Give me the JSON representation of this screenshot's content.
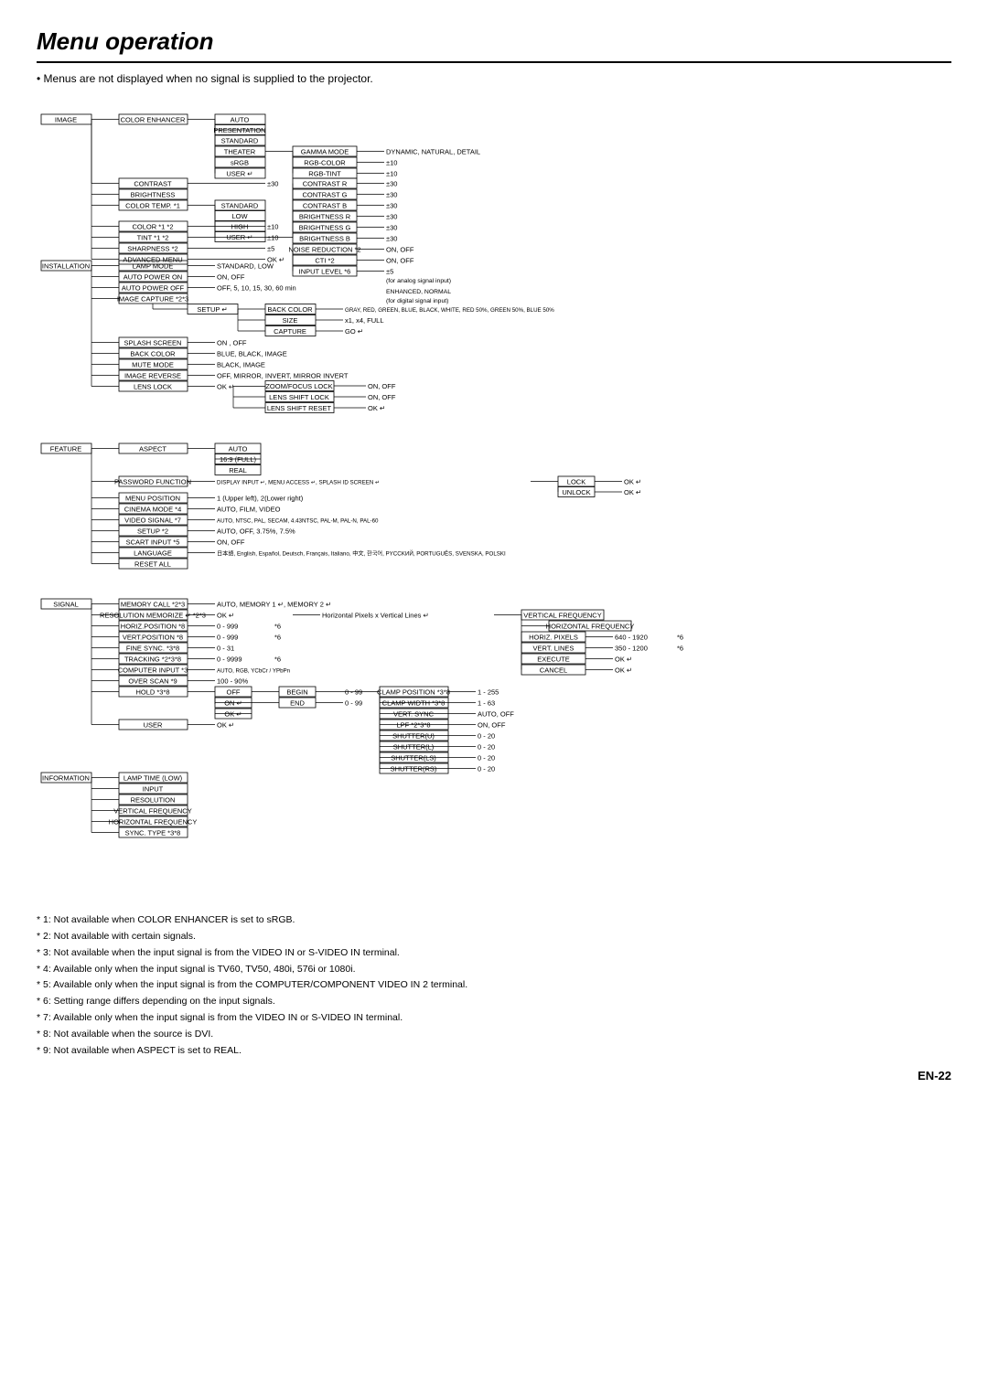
{
  "title": "Menu operation",
  "intro": "Menus are not displayed when no signal is supplied to the projector.",
  "footnotes": [
    "* 1: Not available when COLOR ENHANCER is set to sRGB.",
    "* 2: Not available with certain signals.",
    "* 3: Not available when the input signal is from the VIDEO IN or S-VIDEO IN terminal.",
    "* 4: Available only when the input signal is TV60, TV50, 480i, 576i or 1080i.",
    "* 5: Available only when the input signal is from the COMPUTER/COMPONENT VIDEO IN 2 terminal.",
    "* 6: Setting range differs depending on the input signals.",
    "* 7: Available only when the input signal is from the VIDEO IN or S-VIDEO IN terminal.",
    "* 8: Not available when the source is DVI.",
    "* 9: Not available when ASPECT is set to REAL."
  ],
  "page_number": "EN-22"
}
